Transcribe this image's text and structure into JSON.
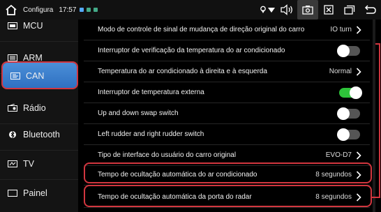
{
  "status_bar": {
    "title": "Configura",
    "time": "17:57",
    "colors": {
      "accent_blue": "#3f83d0",
      "highlight_red": "#d2363f",
      "toggle_on": "#2ec43a"
    }
  },
  "sidebar": {
    "items": [
      {
        "label": "MCU",
        "icon": "mcu-icon"
      },
      {
        "label": "ARM",
        "icon": "arm-icon"
      },
      {
        "label": "CAN",
        "icon": "can-icon",
        "active": true
      },
      {
        "label": "Rádio",
        "icon": "radio-icon"
      },
      {
        "label": "Bluetooth",
        "icon": "bluetooth-icon"
      },
      {
        "label": "TV",
        "icon": "tv-icon"
      },
      {
        "label": "Painel",
        "icon": "panel-icon"
      }
    ]
  },
  "settings": {
    "rows": [
      {
        "label": "Modo de controle de sinal de mudança de direção original do carro",
        "value": "IO turn",
        "type": "select"
      },
      {
        "label": "Interruptor de verificação da temperatura do ar condicionado",
        "type": "toggle",
        "on": false
      },
      {
        "label": "Temperatura do ar condicionado à direita e à esquerda",
        "value": "Normal",
        "type": "select"
      },
      {
        "label": "Interruptor de temperatura externa",
        "type": "toggle",
        "on": true
      },
      {
        "label": "Up and down swap switch",
        "type": "toggle",
        "on": false
      },
      {
        "label": "Left rudder and right rudder switch",
        "type": "toggle",
        "on": false
      },
      {
        "label": "Tipo de interface do usuário do carro original",
        "value": "EVO-D7",
        "type": "select"
      },
      {
        "label": "Tempo de ocultação automática do ar condicionado",
        "value": "8 segundos",
        "type": "select"
      },
      {
        "label": "Tempo de ocultação automática da porta do radar",
        "value": "8 segundos",
        "type": "select"
      }
    ]
  }
}
